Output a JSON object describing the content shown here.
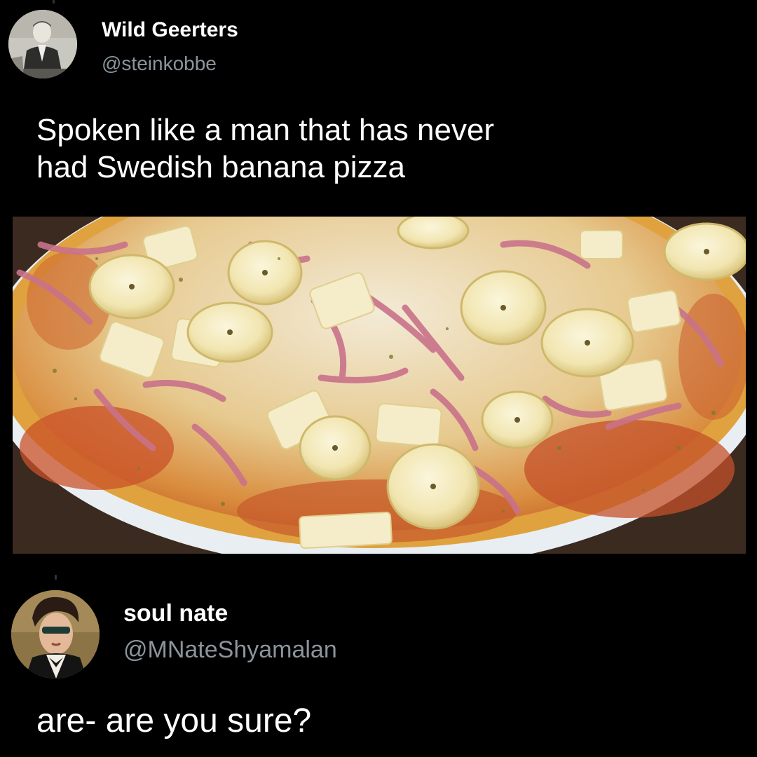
{
  "tweet1": {
    "author_name": "Wild Geerters",
    "author_handle": "@steinkobbe",
    "text": "Spoken like a man that has never\nhad Swedish banana pizza",
    "avatar": "vintage-portrait-photo",
    "media": "banana-pizza-photo"
  },
  "tweet2": {
    "author_name": "soul nate",
    "author_handle": "@MNateShyamalan",
    "text": "are- are you sure?",
    "avatar": "painted-portrait"
  },
  "colors": {
    "background": "#000000",
    "name": "#ffffff",
    "handle": "#8b949b",
    "text": "#ffffff"
  }
}
